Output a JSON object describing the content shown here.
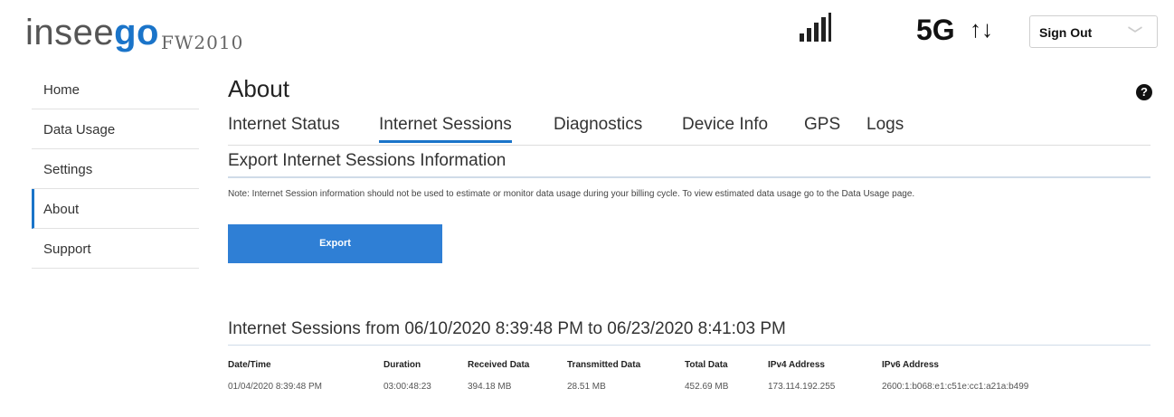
{
  "header": {
    "logo_prefix": "insee",
    "logo_suffix": "go",
    "model": "FW2010",
    "signal_icon": "signal-bars-icon",
    "network_type": "5G",
    "data_arrows": "↑↓",
    "sign_out_label": "Sign Out"
  },
  "sidebar": {
    "items": [
      {
        "label": "Home"
      },
      {
        "label": "Data Usage"
      },
      {
        "label": "Settings"
      },
      {
        "label": "About"
      },
      {
        "label": "Support"
      }
    ]
  },
  "main": {
    "title": "About",
    "help_icon": "?",
    "tabs": [
      {
        "label": "Internet Status"
      },
      {
        "label": "Internet Sessions"
      },
      {
        "label": "Diagnostics"
      },
      {
        "label": "Device Info"
      },
      {
        "label": "GPS"
      },
      {
        "label": "Logs"
      }
    ],
    "section_title": "Export Internet Sessions Information",
    "note": "Note: Internet Session information should not be used to estimate or monitor data usage during your billing cycle. To view estimated data usage go to the Data Usage page.",
    "export_label": "Export",
    "sessions_title": "Internet Sessions from 06/10/2020 8:39:48 PM to 06/23/2020 8:41:03 PM",
    "table": {
      "headers": [
        "Date/Time",
        "Duration",
        "Received Data",
        "Transmitted Data",
        "Total Data",
        "IPv4 Address",
        "IPv6 Address"
      ],
      "rows": [
        [
          "01/04/2020 8:39:48 PM",
          "03:00:48:23",
          "394.18 MB",
          "28.51 MB",
          "452.69 MB",
          "173.114.192.255",
          "2600:1:b068:e1:c51e:cc1:a21a:b499"
        ]
      ]
    }
  },
  "colors": {
    "accent": "#1a74c9",
    "button": "#2f7fd5"
  }
}
